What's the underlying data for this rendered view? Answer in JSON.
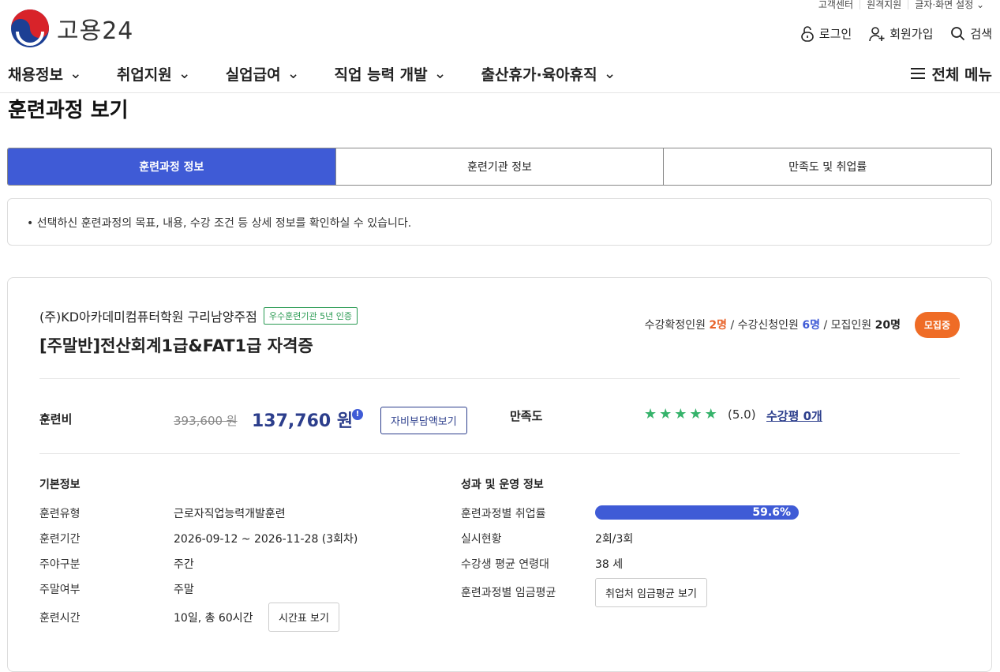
{
  "util_links": [
    "고객센터",
    "원격지원",
    "글자·화면 설정"
  ],
  "logo_text": "고용24",
  "header_actions": {
    "login": "로그인",
    "signup": "회원가입",
    "search": "검색"
  },
  "gnb": [
    "채용정보",
    "취업지원",
    "실업급여",
    "직업 능력 개발",
    "출산휴가·육아휴직"
  ],
  "all_menu": "전체 메뉴",
  "page_title": "훈련과정 보기",
  "tabs": [
    "훈련과정 정보",
    "훈련기관 정보",
    "만족도 및 취업률"
  ],
  "notice": "선택하신 훈련과정의 목표, 내용, 수강 조건 등 상세 정보를 확인하실 수 있습니다.",
  "course": {
    "institution": "(주)KD아카데미컴퓨터학원 구리남양주점",
    "cert_badge": "우수훈련기관 5년 인증",
    "title": "[주말반]전산회계1급&FAT1급 자격증",
    "confirmed_label": "수강확정인원",
    "confirmed": "2명",
    "applied_label": "수강신청인원",
    "applied": "6명",
    "capacity_label": "모집인원",
    "capacity": "20명",
    "status": "모집중",
    "fee_label": "훈련비",
    "fee_original": "393,600 원",
    "fee": "137,760 원",
    "self_pay_button": "자비부담액보기",
    "satisfaction_label": "만족도",
    "rating": 5,
    "rating_text": "(5.0)",
    "review_link": "수강평 0개"
  },
  "basic_info": {
    "heading": "기본정보",
    "rows": [
      {
        "label": "훈련유형",
        "value": "근로자직업능력개발훈련"
      },
      {
        "label": "훈련기간",
        "value": "2026-09-12 ~ 2026-11-28 (3회차)"
      },
      {
        "label": "주야구분",
        "value": "주간"
      },
      {
        "label": "주말여부",
        "value": "주말"
      },
      {
        "label": "훈련시간",
        "value": "10일, 총 60시간"
      }
    ],
    "timetable_button": "시간표 보기"
  },
  "perf_info": {
    "heading": "성과 및 운영 정보",
    "rows": [
      {
        "label": "훈련과정별 취업률",
        "value": "59.6%"
      },
      {
        "label": "실시현황",
        "value": "2회/3회"
      },
      {
        "label": "수강생 평균 연령대",
        "value": "38 세"
      },
      {
        "label": "훈련과정별 임금평균",
        "value": ""
      }
    ],
    "employment_rate": 59.6,
    "wage_button": "취업처 임금평균 보기"
  },
  "colors": {
    "primary": "#3f5bd6",
    "recruit": "#ef6c26",
    "star": "#36b36b",
    "cert": "#2a9a52"
  }
}
